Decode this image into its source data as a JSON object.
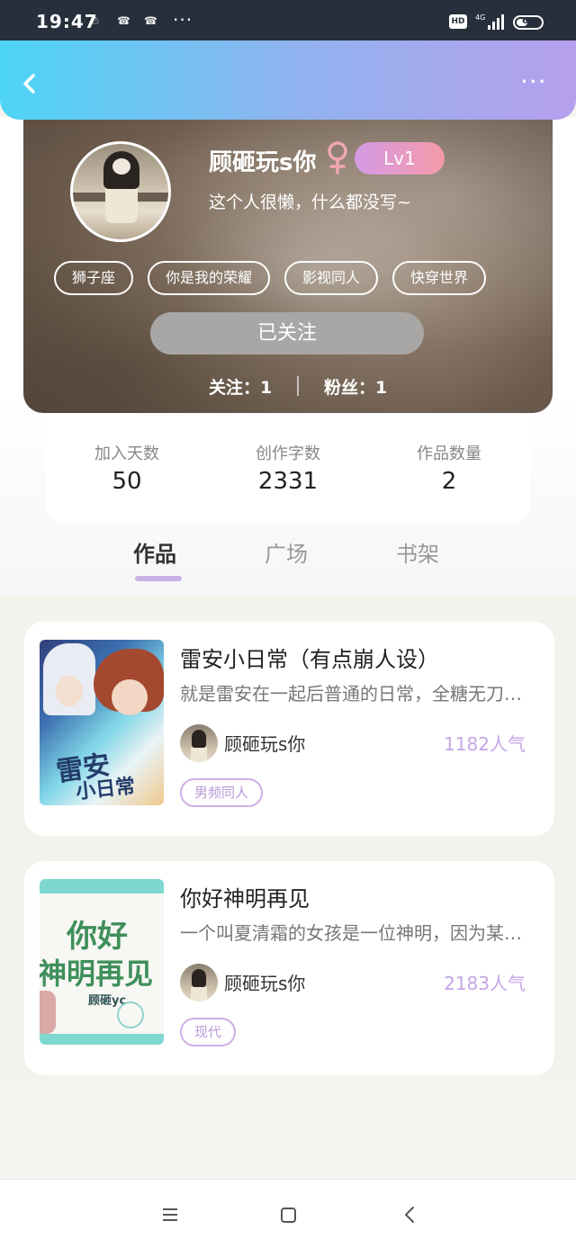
{
  "status_bar": {
    "time": "19:47",
    "notifications": [
      "☃",
      "☎",
      "☎"
    ],
    "more": "···",
    "network": "HD",
    "signal": "4G",
    "battery": "65"
  },
  "header": {
    "back_icon": "chevron-left-icon",
    "more_icon": "more-dots-icon",
    "more": "···"
  },
  "profile": {
    "name": "顾砸玩s你",
    "gender_icon": "female-icon",
    "level": "Lv1",
    "bio": "这个人很懒，什么都没写~",
    "tags": [
      "狮子座",
      "你是我的荣耀",
      "影视同人",
      "快穿世界"
    ],
    "follow_button": "已关注",
    "following": "关注：1",
    "fans": "粉丝：1"
  },
  "stats": {
    "join_days_label": "加入天数",
    "join_days_value": "50",
    "word_count_label": "创作字数",
    "word_count_value": "2331",
    "works_count_label": "作品数量",
    "works_count_value": "2"
  },
  "tabs": [
    {
      "label": "作品",
      "active": true
    },
    {
      "label": "广场",
      "active": false
    },
    {
      "label": "书架",
      "active": false
    }
  ],
  "works": [
    {
      "title": "雷安小日常（有点崩人设）",
      "description": "就是雷安在一起后普通的日常，全糖无刀…",
      "author": "顾砸玩s你",
      "popularity": "1182人气",
      "genre": "男频同人",
      "cover_text": [
        "雷安",
        "小日常"
      ]
    },
    {
      "title": "你好神明再见",
      "description": "一个叫夏清霜的女孩是一位神明，因为某…",
      "author": "顾砸玩s你",
      "popularity": "2183人气",
      "genre": "现代",
      "cover_text": [
        "你好",
        "神明再见",
        "顾砸yc"
      ]
    }
  ],
  "nav_bar": {
    "menu_icon": "menu-icon",
    "home_icon": "home-square-icon",
    "back_icon": "back-triangle-icon"
  },
  "colors": {
    "header_gradient_start": "#4dd5f6",
    "header_gradient_end": "#b69fec",
    "accent_purple": "#c6a5e6",
    "level_badge_start": "#d59ae5",
    "level_badge_end": "#f59aa8"
  }
}
